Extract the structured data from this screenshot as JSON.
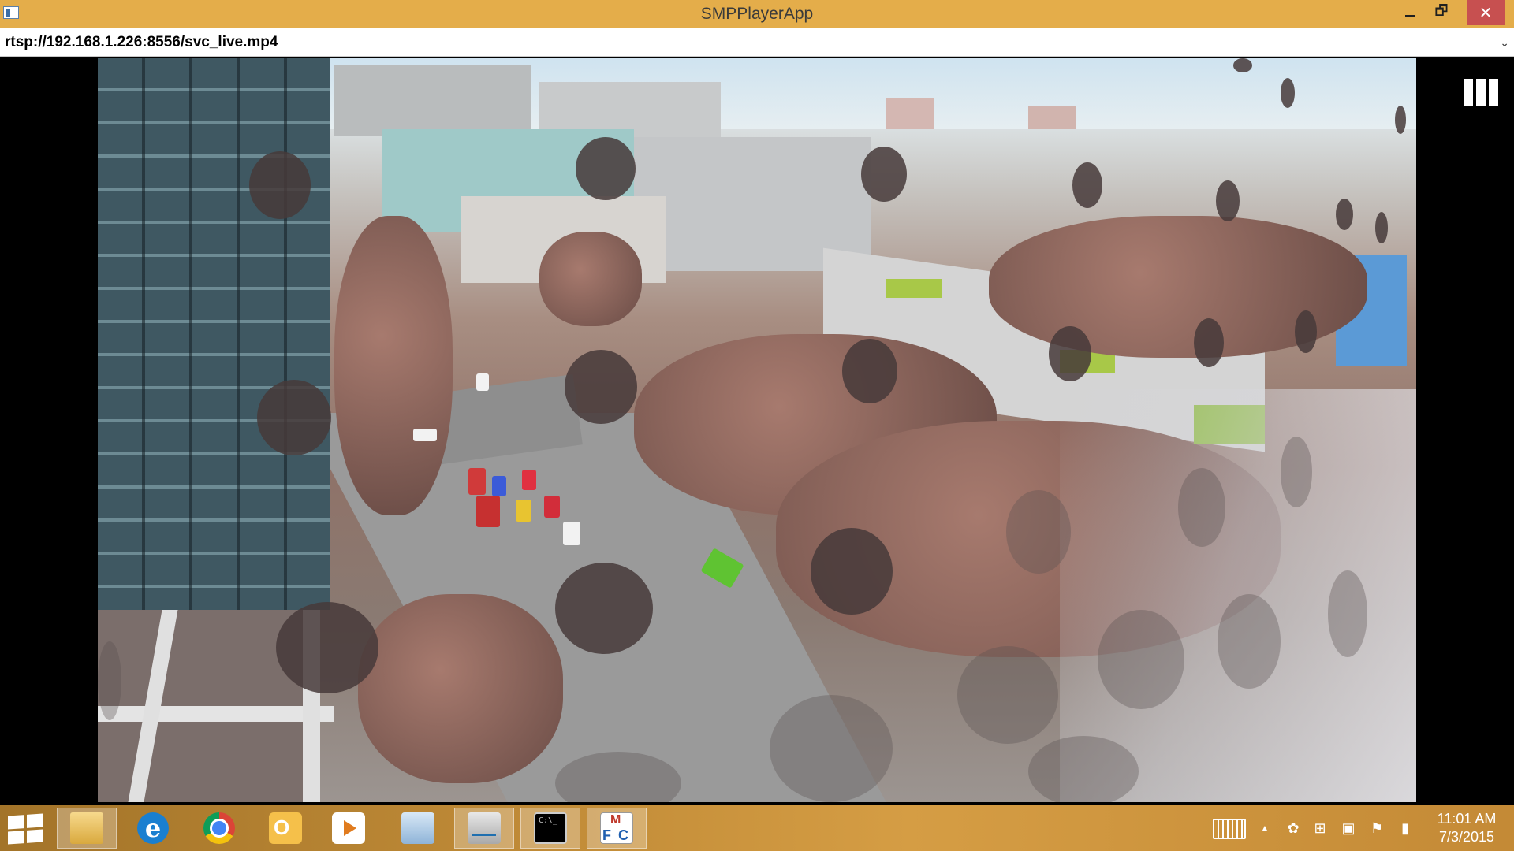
{
  "window": {
    "title": "SMPPlayerApp",
    "minimize_icon": "minimize-icon",
    "restore_icon": "restore-icon",
    "close_icon": "close-icon",
    "restore_glyph": "🗗",
    "close_glyph": "✕"
  },
  "url_bar": {
    "value": "rtsp://192.168.1.226:8556/svc_live.mp4",
    "dropdown_glyph": "⌄"
  },
  "video": {
    "overlay_icon": "columns-icon"
  },
  "taskbar": {
    "start_icon": "windows-start-icon",
    "apps": [
      {
        "name": "file-explorer-icon"
      },
      {
        "name": "internet-explorer-icon",
        "glyph": "e"
      },
      {
        "name": "chrome-icon"
      },
      {
        "name": "outlook-icon"
      },
      {
        "name": "media-player-icon"
      },
      {
        "name": "remote-desktop-icon"
      },
      {
        "name": "performance-monitor-icon"
      },
      {
        "name": "command-prompt-icon"
      },
      {
        "name": "mfc-app-icon",
        "letters": [
          "M",
          "F",
          "C"
        ],
        "active": true
      }
    ],
    "tray": {
      "keyboard_icon": "touch-keyboard-icon",
      "chevron_glyph": "▲",
      "icons_glyphs": [
        "✿",
        "⊞",
        "▣",
        "⚑",
        "▮"
      ],
      "clock_time": "11:01 AM",
      "clock_date": "7/3/2015"
    },
    "accent_color": "#d59d44"
  }
}
